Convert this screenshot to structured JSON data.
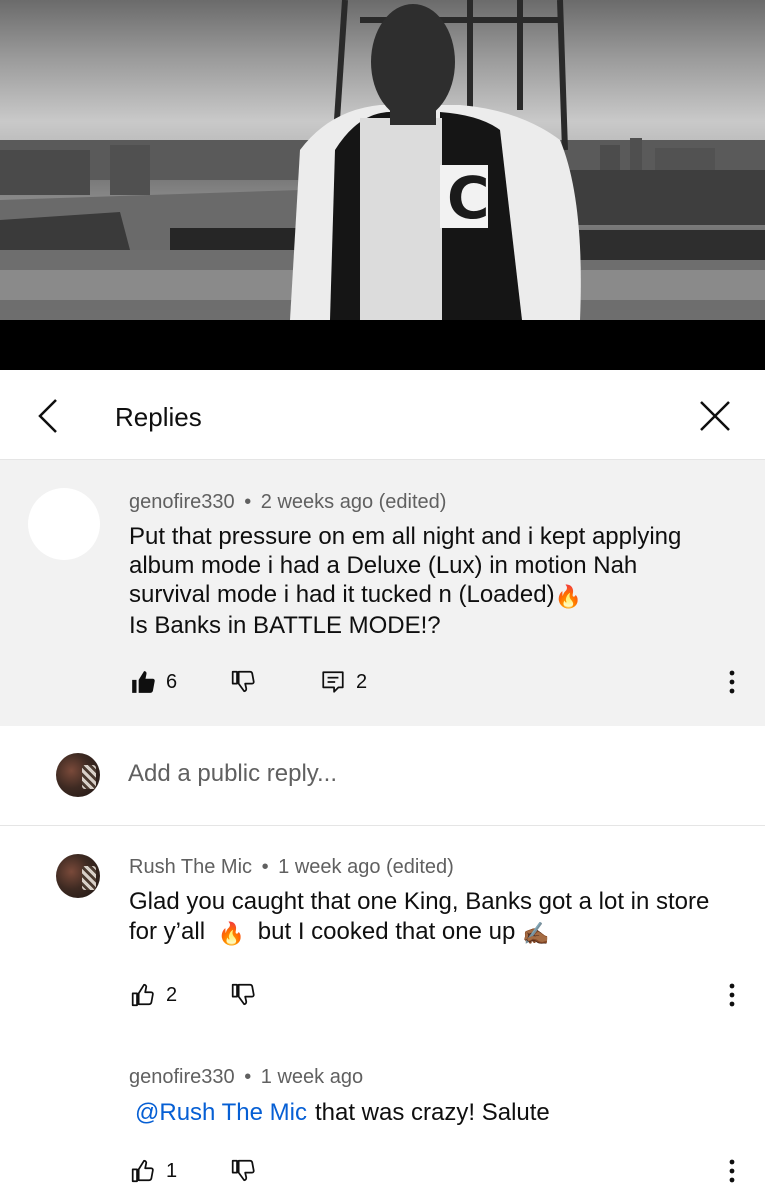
{
  "video": {
    "progress_fraction": 0.085,
    "buffered_fraction": 0.22
  },
  "header": {
    "title": "Replies"
  },
  "parent_comment": {
    "author": "genofire330",
    "separator": "•",
    "time": "2 weeks ago (edited)",
    "lines": [
      "Put that pressure on em all night and i kept applying",
      "album mode i had a Deluxe (Lux) in motion Nah",
      "survival mode i had it tucked n (Loaded)",
      "Is Banks in BATTLE MODE!?"
    ],
    "likes": "6",
    "replies": "2"
  },
  "reply_input": {
    "placeholder": "Add a public reply..."
  },
  "replies": [
    {
      "author": "Rush The Mic",
      "separator": "•",
      "time": "1 week ago (edited)",
      "line1": "Glad you caught that one King, Banks got a lot in store",
      "line2_a": "for y’all",
      "line2_b": "but I cooked that one up",
      "likes": "2"
    },
    {
      "author": "genofire330",
      "separator": "•",
      "time": "1 week ago",
      "mention": "@Rush The Mic",
      "text": "that was crazy! Salute",
      "likes": "1"
    }
  ],
  "icons": {
    "fire": "🔥",
    "writing_hand": "✍🏾"
  },
  "colors": {
    "accent_red": "#e01e1e",
    "link_blue": "#065fd4",
    "secondary_text": "#606060",
    "parent_bg": "#f2f2f2"
  }
}
